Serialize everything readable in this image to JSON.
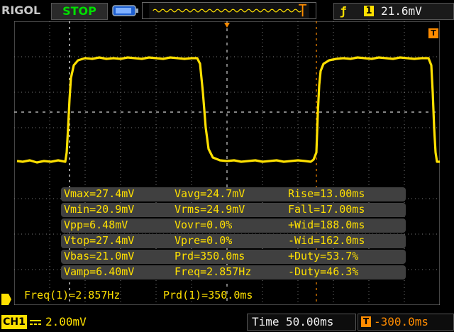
{
  "header": {
    "brand": "RIGOL",
    "run_state": "STOP",
    "trigger": {
      "channel": "1",
      "level": "21.6mV"
    }
  },
  "measurements": [
    [
      "Vmax=27.4mV",
      "Vavg=24.7mV",
      "Rise=13.00ms"
    ],
    [
      "Vmin=20.9mV",
      "Vrms=24.9mV",
      "Fall=17.00ms"
    ],
    [
      "Vpp=6.48mV",
      "Vovr=0.0%",
      "+Wid=188.0ms"
    ],
    [
      "Vtop=27.4mV",
      "Vpre=0.0%",
      "-Wid=162.0ms"
    ],
    [
      "Vbas=21.0mV",
      "Prd=350.0ms",
      "+Duty=53.7%"
    ],
    [
      "Vamp=6.40mV",
      "Freq=2.857Hz",
      "-Duty=46.3%"
    ]
  ],
  "status": {
    "freq": "Freq(1)=2.857Hz",
    "period": "Prd(1)=350.0ms"
  },
  "footer": {
    "channel": "CH1",
    "volts_div": "2.00mV",
    "time_label": "Time",
    "time_div": "50.00ms",
    "trigger_offset": "-300.0ms"
  },
  "trigger_pos_marker": "T",
  "colors": {
    "ch1": "#ffe000",
    "trigger": "#ff8c00",
    "grid": "#9a9a9a",
    "background": "#000000"
  }
}
